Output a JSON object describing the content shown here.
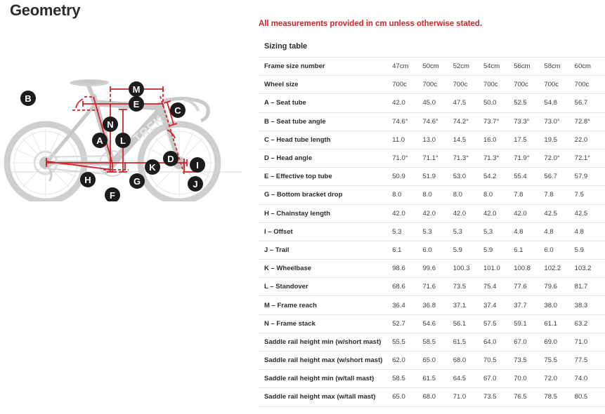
{
  "page_title": "Geometry",
  "note": "All measurements provided in cm unless otherwise stated.",
  "table_caption": "Sizing table",
  "colors": {
    "accent_red": "#d2232a",
    "text_dark": "#2b2b2b",
    "text_body": "#3b3b3b",
    "row_border": "#e3e3e3",
    "bike_gray": "#c9c9c9"
  },
  "diagram": {
    "name": "bicycle-geometry-diagram",
    "brand_mark": "TREK",
    "labels": [
      "A",
      "B",
      "C",
      "D",
      "E",
      "F",
      "G",
      "H",
      "I",
      "J",
      "K",
      "L",
      "M",
      "N"
    ]
  },
  "chart_data": {
    "type": "table",
    "title": "Sizing table",
    "subtitle": "All measurements provided in cm unless otherwise stated.",
    "columns": [
      "Frame size number",
      "47cm",
      "50cm",
      "52cm",
      "54cm",
      "56cm",
      "58cm",
      "60cm"
    ],
    "rows": [
      {
        "label": "Frame size number",
        "values": [
          "47cm",
          "50cm",
          "52cm",
          "54cm",
          "56cm",
          "58cm",
          "60cm"
        ],
        "header": true
      },
      {
        "label": "Wheel size",
        "values": [
          "700c",
          "700c",
          "700c",
          "700c",
          "700c",
          "700c",
          "700c"
        ]
      },
      {
        "label": "A – Seat tube",
        "values": [
          "42.0",
          "45.0",
          "47.5",
          "50.0",
          "52.5",
          "54.8",
          "56.7"
        ]
      },
      {
        "label": "B – Seat tube angle",
        "values": [
          "74.6°",
          "74.6°",
          "74.2°",
          "73.7°",
          "73.3°",
          "73.0°",
          "72.8°"
        ]
      },
      {
        "label": "C – Head tube length",
        "values": [
          "11.0",
          "13.0",
          "14.5",
          "16.0",
          "17.5",
          "19.5",
          "22.0"
        ]
      },
      {
        "label": "D – Head angle",
        "values": [
          "71.0°",
          "71.1°",
          "71.3°",
          "71.3°",
          "71.9°",
          "72.0°",
          "72.1°"
        ]
      },
      {
        "label": "E – Effective top tube",
        "values": [
          "50.9",
          "51.9",
          "53.0",
          "54.2",
          "55.4",
          "56.7",
          "57.9"
        ]
      },
      {
        "label": "G – Bottom bracket drop",
        "values": [
          "8.0",
          "8.0",
          "8.0",
          "8.0",
          "7.8",
          "7.8",
          "7.5"
        ]
      },
      {
        "label": "H – Chainstay length",
        "values": [
          "42.0",
          "42.0",
          "42.0",
          "42.0",
          "42.0",
          "42.5",
          "42.5"
        ]
      },
      {
        "label": "I – Offset",
        "values": [
          "5.3",
          "5.3",
          "5.3",
          "5.3",
          "4.8",
          "4.8",
          "4.8"
        ]
      },
      {
        "label": "J – Trail",
        "values": [
          "6.1",
          "6.0",
          "5.9",
          "5.9",
          "6.1",
          "6.0",
          "5.9"
        ]
      },
      {
        "label": "K – Wheelbase",
        "values": [
          "98.6",
          "99.6",
          "100.3",
          "101.0",
          "100.8",
          "102.2",
          "103.2"
        ]
      },
      {
        "label": "L – Standover",
        "values": [
          "68.6",
          "71.6",
          "73.5",
          "75.4",
          "77.6",
          "79.6",
          "81.7"
        ]
      },
      {
        "label": "M – Frame reach",
        "values": [
          "36.4",
          "36.8",
          "37.1",
          "37.4",
          "37.7",
          "38.0",
          "38.3"
        ]
      },
      {
        "label": "N – Frame stack",
        "values": [
          "52.7",
          "54.6",
          "56.1",
          "57.5",
          "59.1",
          "61.1",
          "63.2"
        ]
      },
      {
        "label": "Saddle rail height min (w/short mast)",
        "values": [
          "55.5",
          "58.5",
          "61.5",
          "64.0",
          "67.0",
          "69.0",
          "71.0"
        ]
      },
      {
        "label": "Saddle rail height max (w/short mast)",
        "values": [
          "62.0",
          "65.0",
          "68.0",
          "70.5",
          "73.5",
          "75.5",
          "77.5"
        ]
      },
      {
        "label": "Saddle rail height min (w/tall mast)",
        "values": [
          "58.5",
          "61.5",
          "64.5",
          "67.0",
          "70.0",
          "72.0",
          "74.0"
        ]
      },
      {
        "label": "Saddle rail height max (w/tall mast)",
        "values": [
          "65.0",
          "68.0",
          "71.0",
          "73.5",
          "76.5",
          "78.5",
          "80.5"
        ]
      }
    ]
  }
}
